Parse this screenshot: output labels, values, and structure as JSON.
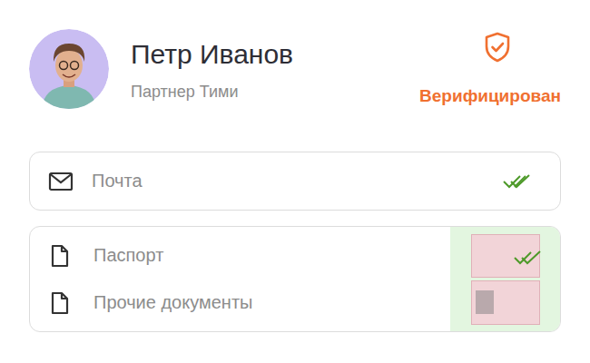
{
  "user": {
    "name": "Петр Иванов",
    "role": "Партнер Тими",
    "verified": true,
    "verified_label": "Верифицирован"
  },
  "contacts": [
    {
      "label": "Почта",
      "confirmed": true
    }
  ],
  "documents": {
    "items": [
      {
        "label": "Паспорт"
      },
      {
        "label": "Прочие документы"
      }
    ],
    "confirmed": true
  }
}
